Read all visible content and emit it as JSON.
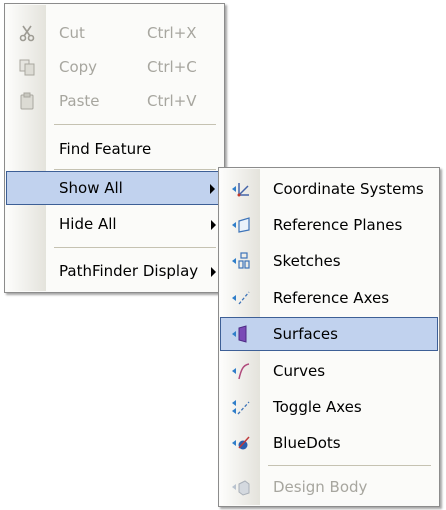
{
  "context_menu": {
    "items": [
      {
        "label": "Cut",
        "shortcut": "Ctrl+X",
        "icon": "scissors-icon",
        "disabled": true
      },
      {
        "label": "Copy",
        "shortcut": "Ctrl+C",
        "icon": "copy-icon",
        "disabled": true
      },
      {
        "label": "Paste",
        "shortcut": "Ctrl+V",
        "icon": "paste-icon",
        "disabled": true
      },
      {
        "label": "Find Feature"
      },
      {
        "label": "Show All",
        "has_submenu": true,
        "highlighted": true
      },
      {
        "label": "Hide All",
        "has_submenu": true
      },
      {
        "label": "PathFinder Display",
        "has_submenu": true
      }
    ]
  },
  "submenu": {
    "items": [
      {
        "label": "Coordinate Systems",
        "icon": "coordinate-systems-icon"
      },
      {
        "label": "Reference Planes",
        "icon": "reference-planes-icon"
      },
      {
        "label": "Sketches",
        "icon": "sketches-icon"
      },
      {
        "label": "Reference Axes",
        "icon": "reference-axes-icon"
      },
      {
        "label": "Surfaces",
        "icon": "surfaces-icon",
        "highlighted": true
      },
      {
        "label": "Curves",
        "icon": "curves-icon"
      },
      {
        "label": "Toggle Axes",
        "icon": "toggle-axes-icon"
      },
      {
        "label": "BlueDots",
        "icon": "bluedots-icon"
      },
      {
        "label": "Design Body",
        "icon": "design-body-icon",
        "disabled": true
      }
    ]
  },
  "colors": {
    "highlight": "#c1d2ee",
    "highlight_border": "#3d5f96",
    "disabled_text": "#a7a69f"
  }
}
